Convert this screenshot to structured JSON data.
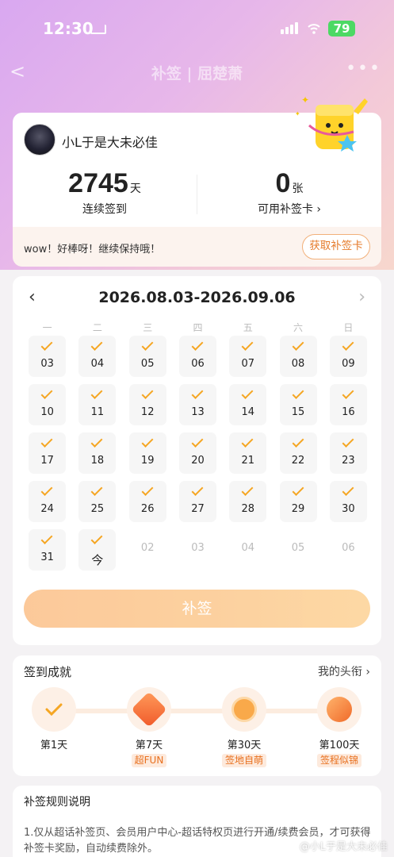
{
  "status": {
    "time": "12:30",
    "battery": "79"
  },
  "nav": {
    "back": "<",
    "title": "补签 | 屈楚萧",
    "more": "•••"
  },
  "user": {
    "name": "小L于是大未必佳"
  },
  "stats": {
    "streak_num": "2745",
    "streak_unit": "天",
    "streak_label": "连续签到",
    "cards_num": "0",
    "cards_unit": "张",
    "cards_label": "可用补签卡 ›"
  },
  "encourage": {
    "text": "wow！好棒呀！继续保持哦！",
    "button": "获取补签卡"
  },
  "calendar": {
    "prev": "‹",
    "next": "›",
    "range": "2026.08.03-2026.09.06",
    "weekdays": [
      "一",
      "二",
      "三",
      "四",
      "五",
      "六",
      "日"
    ],
    "days": [
      {
        "n": "03",
        "s": true
      },
      {
        "n": "04",
        "s": true
      },
      {
        "n": "05",
        "s": true
      },
      {
        "n": "06",
        "s": true
      },
      {
        "n": "07",
        "s": true
      },
      {
        "n": "08",
        "s": true
      },
      {
        "n": "09",
        "s": true
      },
      {
        "n": "10",
        "s": true
      },
      {
        "n": "11",
        "s": true
      },
      {
        "n": "12",
        "s": true
      },
      {
        "n": "13",
        "s": true
      },
      {
        "n": "14",
        "s": true
      },
      {
        "n": "15",
        "s": true
      },
      {
        "n": "16",
        "s": true
      },
      {
        "n": "17",
        "s": true
      },
      {
        "n": "18",
        "s": true
      },
      {
        "n": "19",
        "s": true
      },
      {
        "n": "20",
        "s": true
      },
      {
        "n": "21",
        "s": true
      },
      {
        "n": "22",
        "s": true
      },
      {
        "n": "23",
        "s": true
      },
      {
        "n": "24",
        "s": true
      },
      {
        "n": "25",
        "s": true
      },
      {
        "n": "26",
        "s": true
      },
      {
        "n": "27",
        "s": true
      },
      {
        "n": "28",
        "s": true
      },
      {
        "n": "29",
        "s": true
      },
      {
        "n": "30",
        "s": true
      },
      {
        "n": "31",
        "s": true
      },
      {
        "n": "今",
        "s": true,
        "today": true
      },
      {
        "n": "02",
        "s": false
      },
      {
        "n": "03",
        "s": false
      },
      {
        "n": "04",
        "s": false
      },
      {
        "n": "05",
        "s": false
      },
      {
        "n": "06",
        "s": false
      }
    ],
    "button": "补签"
  },
  "achievements": {
    "title": "签到成就",
    "link": "我的头衔 ›",
    "items": [
      {
        "label": "第1天",
        "tag": ""
      },
      {
        "label": "第7天",
        "tag": "超FUN"
      },
      {
        "label": "第30天",
        "tag": "签地自萌"
      },
      {
        "label": "第100天",
        "tag": "签程似锦"
      }
    ]
  },
  "rules": {
    "title": "补签规则说明",
    "text": "1.仅从超话补签页、会员用户中心-超话特权页进行开通/续费会员，才可获得补签卡奖励，自动续费除外。"
  },
  "watermark": "@小L于是大未必佳",
  "colors": {
    "accent": "#f5a623",
    "orange_text": "#e8701e",
    "battery": "#4cd964"
  }
}
